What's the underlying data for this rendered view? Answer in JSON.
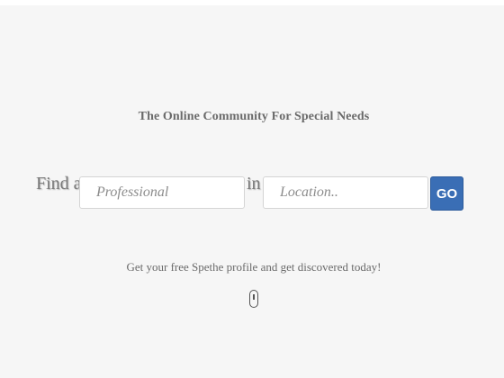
{
  "hero": {
    "tagline": "The Online Community For Special Needs",
    "subtext": "Get your free Spethe profile and get discovered today!"
  },
  "search": {
    "find_label": "Find a",
    "professional_placeholder": "Professional",
    "in_label": "in",
    "location_placeholder": "Location..",
    "go_label": "GO"
  },
  "colors": {
    "accent": "#3a6eb5",
    "background": "#f6f6f6",
    "text": "#6a6a6a"
  },
  "icons": {
    "scroll": "mouse-scroll-icon"
  }
}
